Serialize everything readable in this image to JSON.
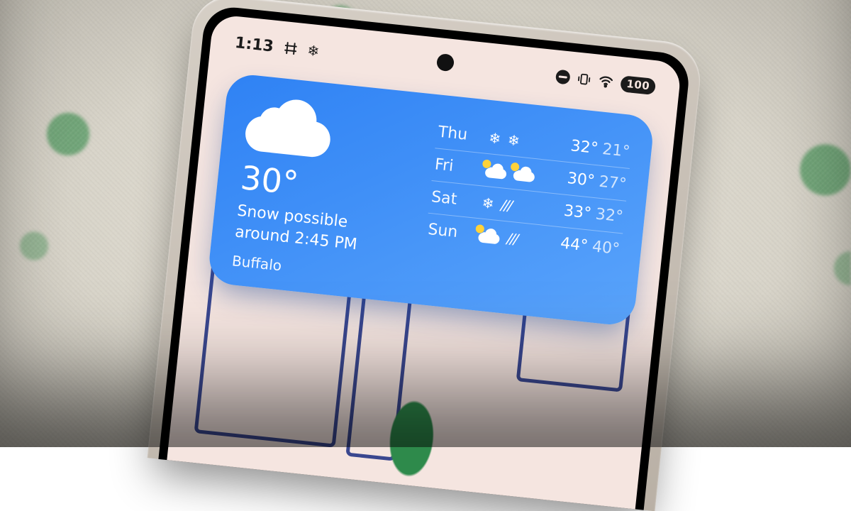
{
  "status": {
    "time": "1:13",
    "battery": "100"
  },
  "weather": {
    "temp": "30°",
    "condition_line1": "Snow possible",
    "condition_line2": "around 2:45 PM",
    "city": "Buffalo",
    "forecast": [
      {
        "day": "Thu",
        "icon1": "snow",
        "icon2": "snow",
        "hi": "32°",
        "lo": "21°"
      },
      {
        "day": "Fri",
        "icon1": "cloud-sun",
        "icon2": "cloud-sun",
        "hi": "30°",
        "lo": "27°"
      },
      {
        "day": "Sat",
        "icon1": "snow",
        "icon2": "rain",
        "hi": "33°",
        "lo": "32°"
      },
      {
        "day": "Sun",
        "icon1": "cloud-sun",
        "icon2": "rain",
        "hi": "44°",
        "lo": "40°"
      }
    ]
  }
}
